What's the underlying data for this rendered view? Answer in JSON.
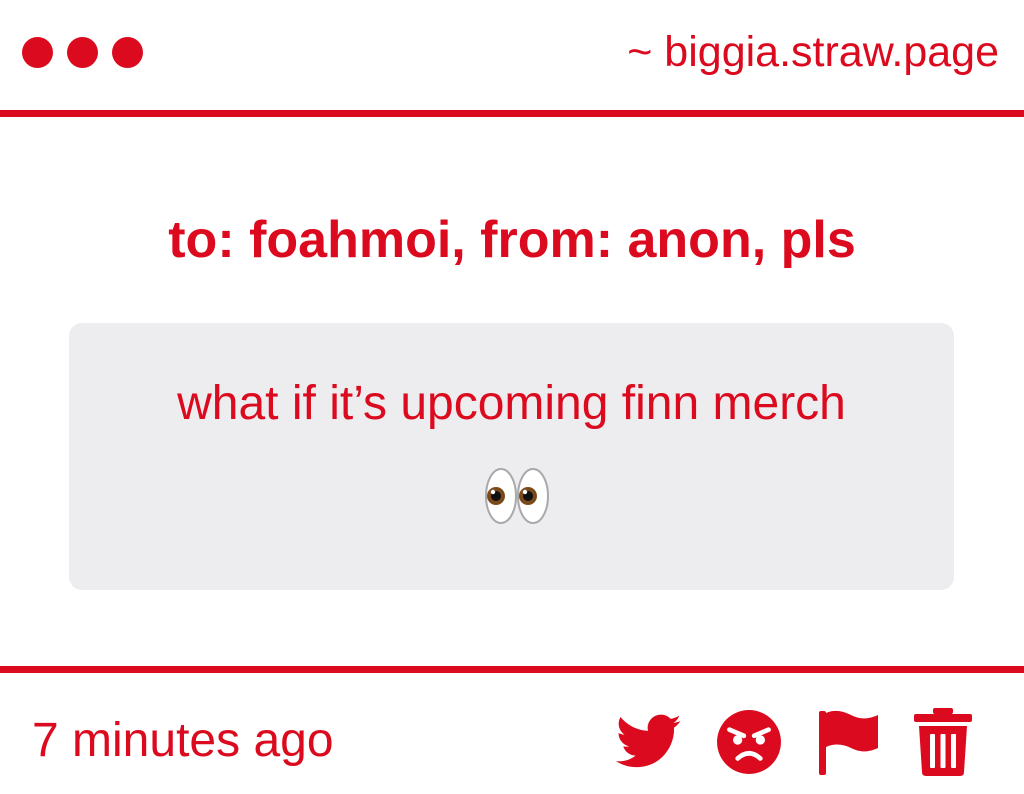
{
  "header": {
    "site": "~ biggia.straw.page",
    "window_dots": [
      "dot",
      "dot",
      "dot"
    ]
  },
  "message": {
    "title": "to: foahmoi, from: anon, pls",
    "body": "what if it’s upcoming finn merch",
    "emoji": "eyes-emoji"
  },
  "footer": {
    "timestamp": "7 minutes ago",
    "actions": [
      "twitter-icon",
      "angry-face-icon",
      "flag-icon",
      "trash-icon"
    ]
  },
  "colors": {
    "accent": "#dc0a1e",
    "card_bg": "#edecee",
    "background": "#ffffff"
  }
}
